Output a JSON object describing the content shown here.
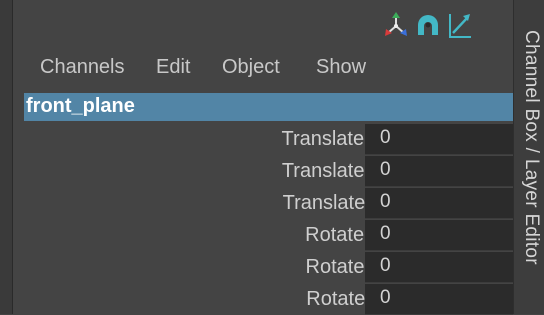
{
  "side_tab": {
    "label": "Channel Box / Layer Editor"
  },
  "toolbar": {
    "icons": [
      "axis-transform-icon",
      "channel-box-icon",
      "layer-editor-icon"
    ]
  },
  "menubar": {
    "items": [
      "Channels",
      "Edit",
      "Object",
      "Show"
    ]
  },
  "object": {
    "name": "front_plane"
  },
  "channels": [
    {
      "label": "Translate X",
      "value": "0"
    },
    {
      "label": "Translate Y",
      "value": "0"
    },
    {
      "label": "Translate Z",
      "value": "0"
    },
    {
      "label": "Rotate X",
      "value": "0"
    },
    {
      "label": "Rotate Y",
      "value": "0"
    },
    {
      "label": "Rotate Z",
      "value": "0"
    }
  ],
  "colors": {
    "panel_bg": "#444444",
    "selection": "#5285a6",
    "field_bg": "#2b2b2b",
    "icon_teal": "#43b8c6",
    "icon_green": "#3cae5a",
    "icon_red": "#d93b3b",
    "icon_blue": "#3b6fd9"
  }
}
